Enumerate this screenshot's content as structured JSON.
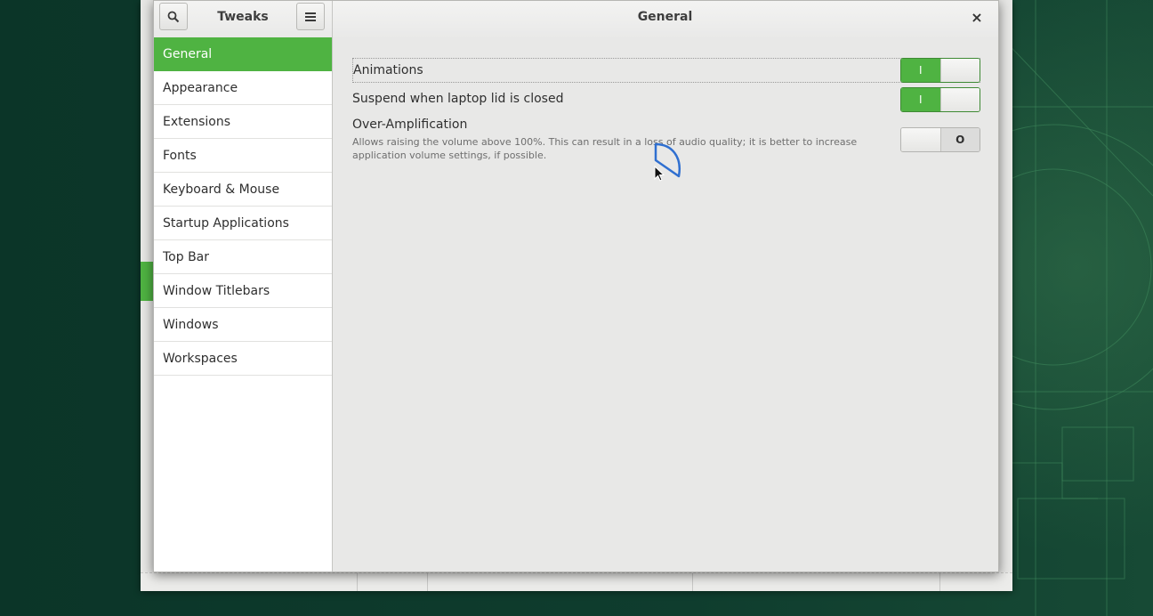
{
  "app": {
    "title": "Tweaks",
    "page_title": "General"
  },
  "header": {
    "search_icon": "search-icon",
    "menu_icon": "hamburger-menu-icon",
    "close_glyph": "×"
  },
  "sidebar": {
    "items": [
      {
        "label": "General",
        "active": true
      },
      {
        "label": "Appearance"
      },
      {
        "label": "Extensions"
      },
      {
        "label": "Fonts"
      },
      {
        "label": "Keyboard & Mouse"
      },
      {
        "label": "Startup Applications"
      },
      {
        "label": "Top Bar"
      },
      {
        "label": "Window Titlebars"
      },
      {
        "label": "Windows"
      },
      {
        "label": "Workspaces"
      }
    ]
  },
  "settings": {
    "animations": {
      "label": "Animations",
      "state": "on",
      "on_glyph": "I"
    },
    "suspend": {
      "label": "Suspend when laptop lid is closed",
      "state": "on",
      "on_glyph": "I"
    },
    "over_amplification": {
      "label": "Over-Amplification",
      "description": "Allows raising the volume above 100%. This can result in a loss of audio quality; it is better to increase application volume settings, if possible.",
      "state": "off",
      "off_glyph": "O"
    }
  },
  "colors": {
    "accent": "#4fb342",
    "desktop": "#0e3b2c"
  }
}
